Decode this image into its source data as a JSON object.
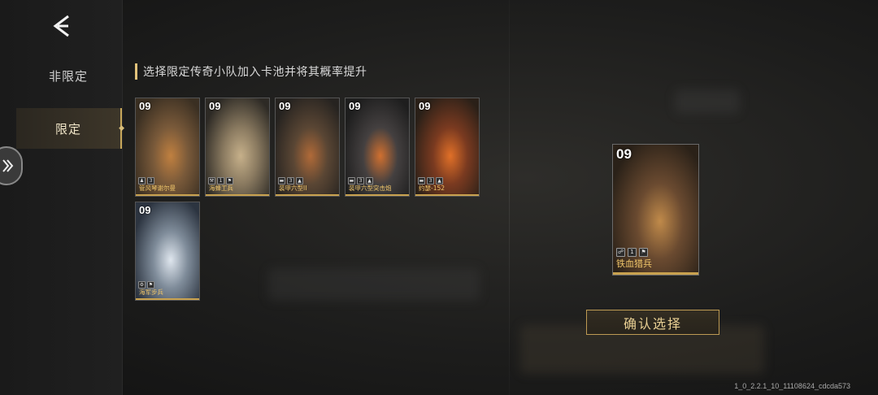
{
  "sidebar": {
    "tabs": [
      {
        "label": "非限定",
        "active": false
      },
      {
        "label": "限定",
        "active": true
      }
    ]
  },
  "hint": {
    "text": "选择限定传奇小队加入卡池并将其概率提升"
  },
  "cards": [
    {
      "level": "09",
      "name": "管风琴谢尔曼",
      "stats": [
        "♟",
        "3"
      ],
      "art": [
        "#3a2f22",
        "#7a5a3a",
        "#c08040"
      ]
    },
    {
      "level": "09",
      "name": "海蜂工兵",
      "stats": [
        "⚒",
        "1",
        "⚑"
      ],
      "art": [
        "#2d2a25",
        "#8a7a60",
        "#c6b08a"
      ]
    },
    {
      "level": "09",
      "name": "装甲六型II",
      "stats": [
        "▬",
        "3",
        "▲"
      ],
      "art": [
        "#262320",
        "#5a4634",
        "#b06a38"
      ]
    },
    {
      "level": "09",
      "name": "装甲六型突击炮",
      "stats": [
        "▬",
        "3",
        "▲"
      ],
      "art": [
        "#1e1e1e",
        "#444040",
        "#d07030"
      ]
    },
    {
      "level": "09",
      "name": "约瑟-152",
      "stats": [
        "▬",
        "3",
        "▲"
      ],
      "art": [
        "#2a2018",
        "#7a3a20",
        "#e07028"
      ]
    },
    {
      "level": "09",
      "name": "海军步兵",
      "stats": [
        "⚙",
        "⚑"
      ],
      "art": [
        "#2c3440",
        "#7f8c9a",
        "#dfe6ee"
      ]
    }
  ],
  "selected": {
    "level": "09",
    "name": "铁血猎兵",
    "stats": [
      "☍",
      "1",
      "⚑"
    ],
    "art": [
      "#2a2118",
      "#6a4a30",
      "#c08a4a"
    ]
  },
  "confirm_label": "确认选择",
  "version": "1_0_2.2.1_10_11108624_cdcda573",
  "colors": {
    "accent": "#c9a24f",
    "name_text": "#f0c66a"
  }
}
